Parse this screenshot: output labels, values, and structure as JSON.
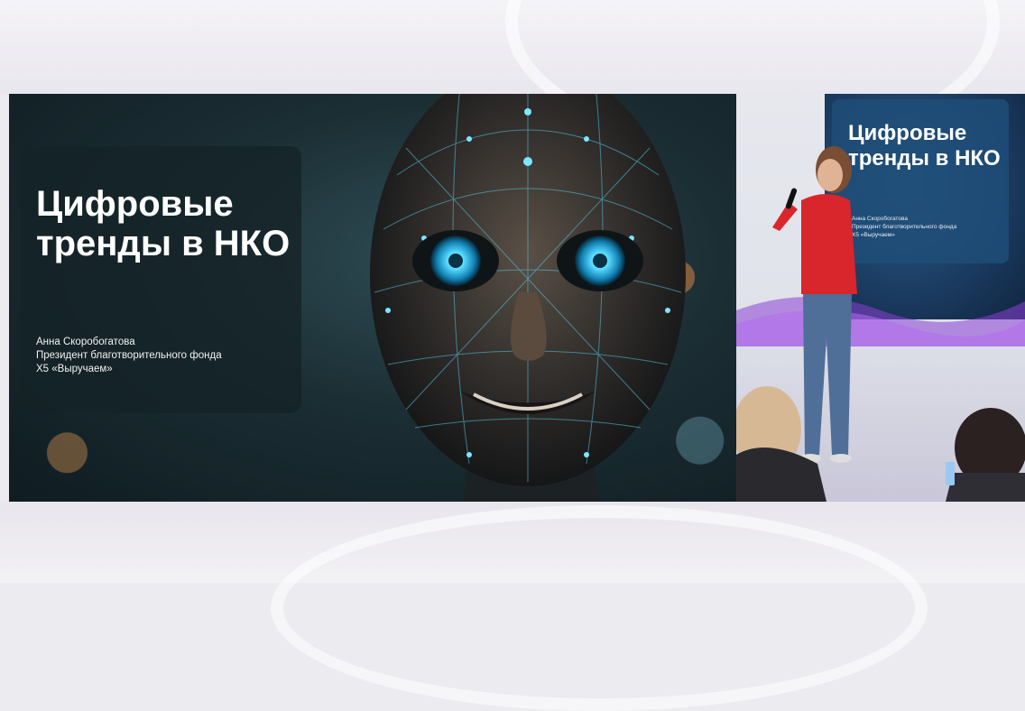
{
  "slide": {
    "title_lines": [
      "Цифровые",
      "тренды в НКО"
    ],
    "author_lines": [
      "Анна Скоробогатова",
      "Президент благотворительного фонда",
      "Х5 «Выручаем»"
    ]
  },
  "stage_screen": {
    "title_lines": [
      "Цифровые",
      "тренды в НКО"
    ],
    "author_lines": [
      "Анна Скоробогатова",
      "Президент благотворительного фонда",
      "Х5 «Выручаем»"
    ]
  },
  "colors": {
    "slide_bg": "#1b2e34",
    "face_glow": "#3fd2ff",
    "speaker_top": "#d9262c",
    "speaker_jeans": "#4f6f99",
    "stage_screen": "#1a3a5f",
    "stage_wave": "#8b3fd6"
  }
}
